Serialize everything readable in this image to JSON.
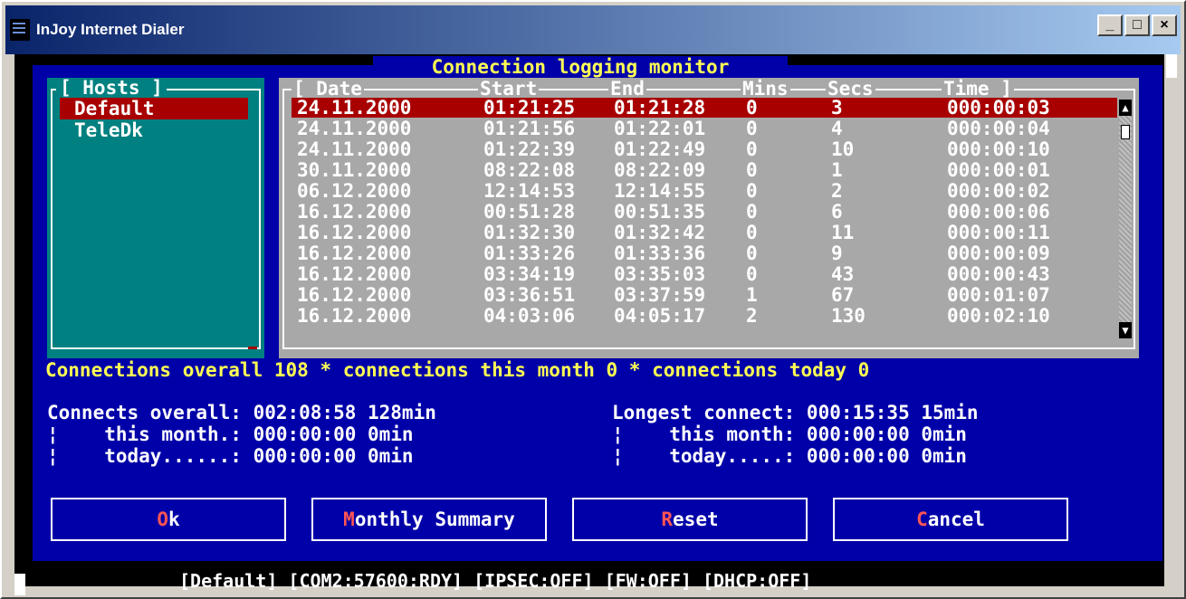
{
  "window": {
    "title": "InJoy Internet Dialer",
    "controls": [
      "_",
      "□",
      "×"
    ]
  },
  "dialog": {
    "title": "Connection logging monitor",
    "hosts": {
      "header": "[ Hosts ]",
      "items": [
        "Default",
        "TeleDk"
      ],
      "selected": 0
    },
    "log": {
      "columns": [
        "[ Date",
        "Start",
        "End",
        "Mins",
        "Secs",
        "Time ]"
      ],
      "rows": [
        [
          "24.11.2000",
          "01:21:25",
          "01:21:28",
          "0",
          "3",
          "000:00:03"
        ],
        [
          "24.11.2000",
          "01:21:56",
          "01:22:01",
          "0",
          "4",
          "000:00:04"
        ],
        [
          "24.11.2000",
          "01:22:39",
          "01:22:49",
          "0",
          "10",
          "000:00:10"
        ],
        [
          "30.11.2000",
          "08:22:08",
          "08:22:09",
          "0",
          "1",
          "000:00:01"
        ],
        [
          "06.12.2000",
          "12:14:53",
          "12:14:55",
          "0",
          "2",
          "000:00:02"
        ],
        [
          "16.12.2000",
          "00:51:28",
          "00:51:35",
          "0",
          "6",
          "000:00:06"
        ],
        [
          "16.12.2000",
          "01:32:30",
          "01:32:42",
          "0",
          "11",
          "000:00:11"
        ],
        [
          "16.12.2000",
          "01:33:26",
          "01:33:36",
          "0",
          "9",
          "000:00:09"
        ],
        [
          "16.12.2000",
          "03:34:19",
          "03:35:03",
          "0",
          "43",
          "000:00:43"
        ],
        [
          "16.12.2000",
          "03:36:51",
          "03:37:59",
          "1",
          "67",
          "000:01:07"
        ],
        [
          "16.12.2000",
          "04:03:06",
          "04:05:17",
          "2",
          "130",
          "000:02:10"
        ]
      ],
      "selected_row": 0
    },
    "summary_line": "Connections overall 108 * connections this month 0 * connections today 0",
    "stats_left": [
      "Connects overall: 002:08:58 128min",
      "¦    this month.: 000:00:00 0min",
      "¦    today......: 000:00:00 0min"
    ],
    "stats_right": [
      "Longest connect: 000:15:35 15min",
      "¦    this month: 000:00:00 0min",
      "¦    today.....: 000:00:00 0min"
    ],
    "buttons": [
      {
        "hotkey": "O",
        "rest": "k"
      },
      {
        "hotkey": "M",
        "rest": "onthly Summary"
      },
      {
        "hotkey": "R",
        "rest": "eset"
      },
      {
        "hotkey": "C",
        "rest": "ancel"
      }
    ]
  },
  "status_bar": "[Default] [COM2:57600:RDY] [IPSEC:OFF] [FW:OFF] [DHCP:OFF]",
  "colors": {
    "background": "#0000a8",
    "highlight": "#a80000",
    "accent_text": "#ffff54",
    "hosts_panel": "#008080",
    "log_panel": "#a8a8a8"
  }
}
